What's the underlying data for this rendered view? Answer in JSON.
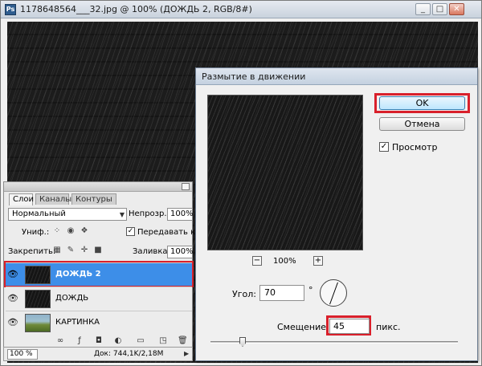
{
  "window": {
    "title": "1178648564___32.jpg @ 100% (ДОЖДЬ 2, RGB/8#)",
    "ps_icon": "Ps",
    "controls": {
      "minimize": "_",
      "maximize": "□",
      "close": "✕"
    }
  },
  "layers_panel": {
    "tabs": [
      {
        "label": "Слои",
        "active": true
      },
      {
        "label": "Каналы",
        "active": false
      },
      {
        "label": "Контуры",
        "active": false
      }
    ],
    "blend_mode": "Нормальный",
    "opacity_label": "Непрозр.:",
    "opacity_value": "100%",
    "unify_label": "Униф.:",
    "propagate_label": "Передавать кадр",
    "propagate_checked": "✓",
    "lock_label": "Закрепить:",
    "fill_label": "Заливка:",
    "fill_value": "100%",
    "layers": [
      {
        "name": "ДОЖДЬ 2",
        "selected": true,
        "thumbnail": "rain-dark"
      },
      {
        "name": "ДОЖДЬ",
        "selected": false,
        "thumbnail": "rain-dark"
      },
      {
        "name": "КАРТИНКА",
        "selected": false,
        "thumbnail": "landscape"
      }
    ],
    "footer_icons": [
      "link-icon",
      "fx-icon",
      "mask-icon",
      "adjustment-icon",
      "folder-icon",
      "new-layer-icon",
      "trash-icon"
    ]
  },
  "statusbar": {
    "zoom": "100 %",
    "doc_info": "Док: 744,1K/2,18M"
  },
  "dialog": {
    "title": "Размытие в движении",
    "ok_label": "OK",
    "cancel_label": "Отмена",
    "preview_label": "Просмотр",
    "preview_checked": "✓",
    "zoom_minus": "−",
    "zoom_plus": "+",
    "zoom_value": "100%",
    "angle_label": "Угол:",
    "angle_value": "70",
    "degree_symbol": "°",
    "offset_label": "Смещение:",
    "offset_value": "45",
    "offset_unit": "пикс.",
    "highlight_color": "#d9202b",
    "selection_color": "#3d8ee8"
  }
}
